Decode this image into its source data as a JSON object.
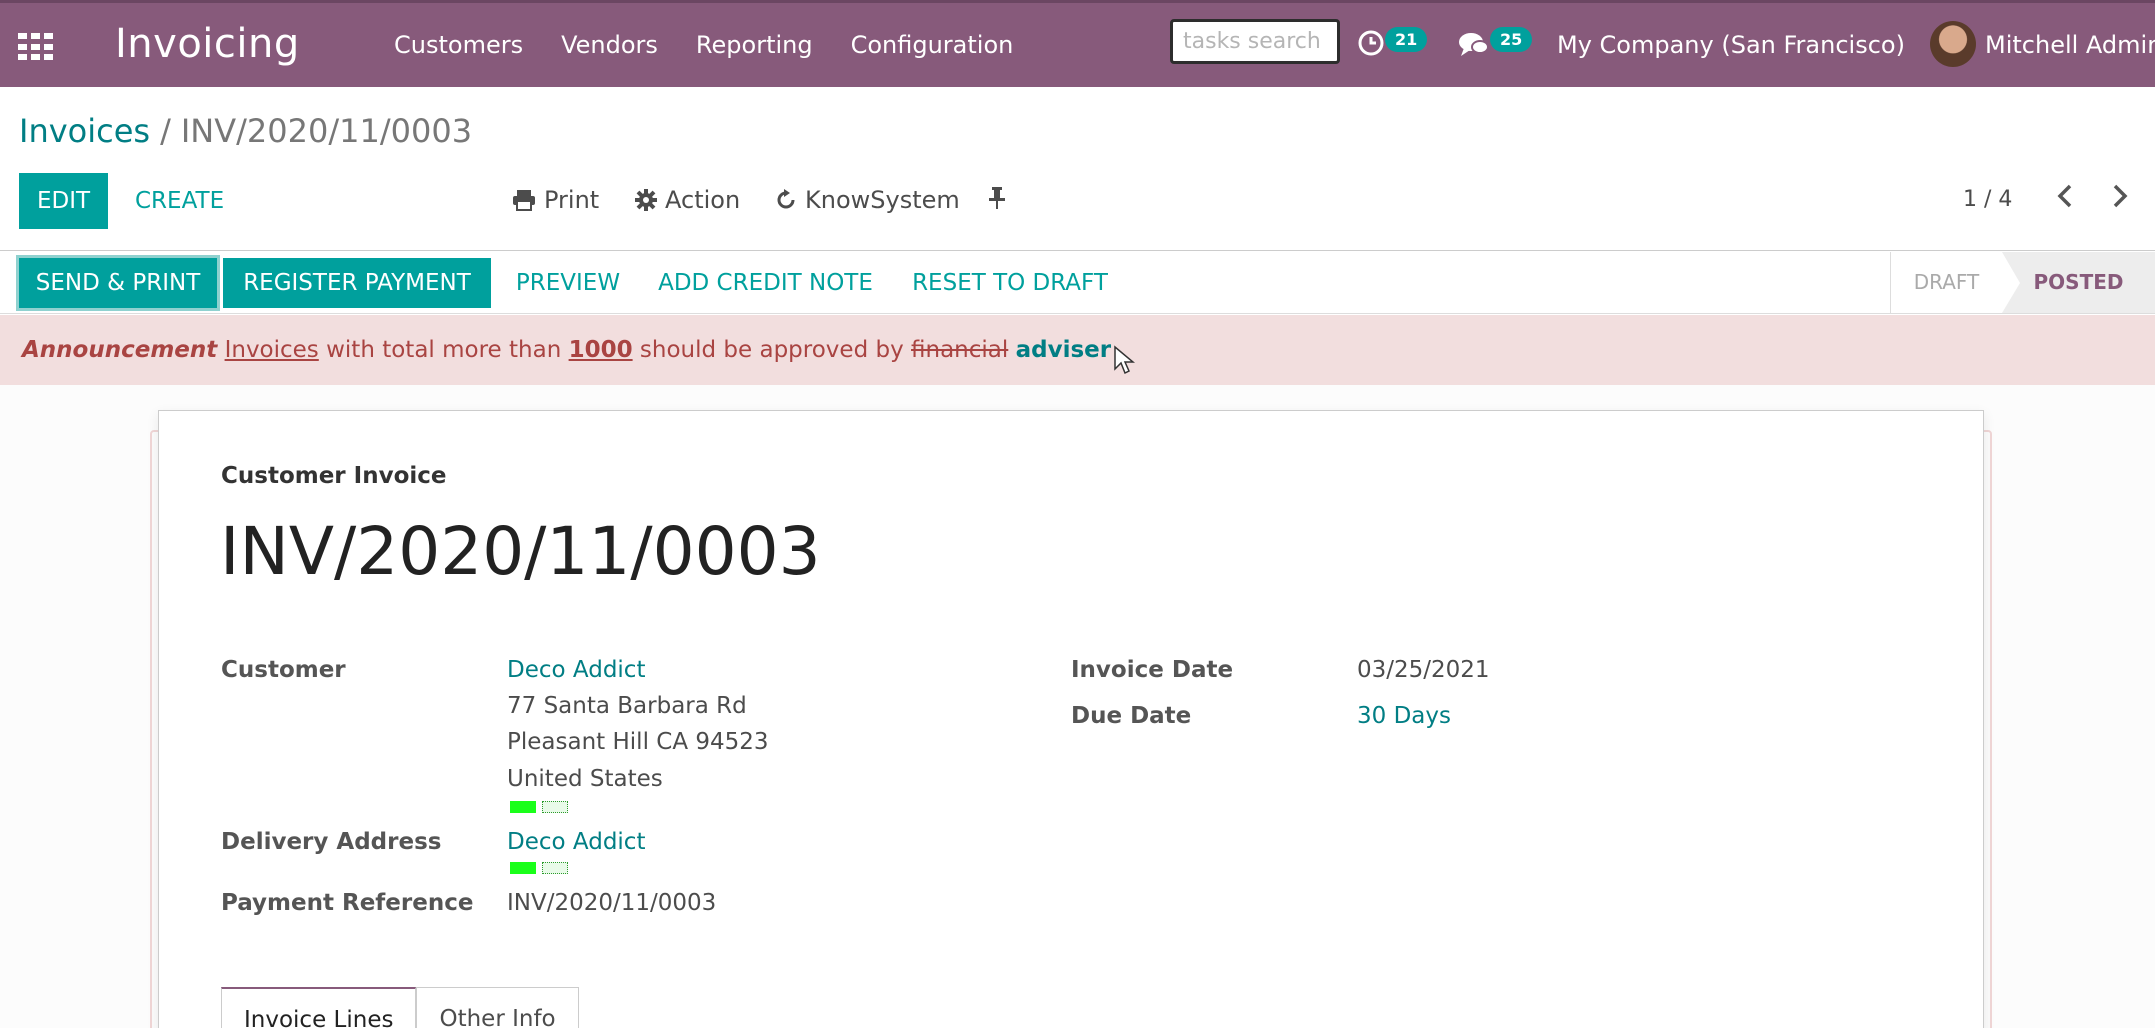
{
  "topnav": {
    "app_title": "Invoicing",
    "menu": [
      "Customers",
      "Vendors",
      "Reporting",
      "Configuration"
    ],
    "search_placeholder": "tasks search",
    "activity_count": "21",
    "message_count": "25",
    "company": "My Company (San Francisco)",
    "user": "Mitchell Admin"
  },
  "breadcrumb": {
    "parent": "Invoices",
    "separator": "/",
    "current": "INV/2020/11/0003"
  },
  "toolbar": {
    "edit_label": "EDIT",
    "create_label": "CREATE",
    "print_label": "Print",
    "action_label": "Action",
    "knowsystem_label": "KnowSystem"
  },
  "pager": {
    "value": "1 / 4"
  },
  "statusbar": {
    "send_print": "SEND & PRINT",
    "register_payment": "REGISTER PAYMENT",
    "preview": "PREVIEW",
    "add_credit_note": "ADD CREDIT NOTE",
    "reset_to_draft": "RESET TO DRAFT",
    "stages": [
      "DRAFT",
      "POSTED"
    ]
  },
  "announcement": {
    "title": "Announcement",
    "link": "Invoices",
    "text1": "with total more than",
    "amount": "1000",
    "text2": "should be approved by",
    "struck": "financial",
    "role": "adviser"
  },
  "invoice": {
    "doc_type": "Customer Invoice",
    "name": "INV/2020/11/0003",
    "customer_label": "Customer",
    "customer": "Deco Addict",
    "address_line1": "77 Santa Barbara Rd",
    "address_line2": "Pleasant Hill CA 94523",
    "address_line3": "United States",
    "delivery_label": "Delivery Address",
    "delivery": "Deco Addict",
    "payment_ref_label": "Payment Reference",
    "payment_ref": "INV/2020/11/0003",
    "invoice_date_label": "Invoice Date",
    "invoice_date": "03/25/2021",
    "due_date_label": "Due Date",
    "due_date": "30 Days"
  },
  "tabs": [
    "Invoice Lines",
    "Other Info"
  ],
  "colors": {
    "brand": "#875a7b",
    "accent": "#00a09d",
    "announcement_bg": "#f2dede"
  }
}
